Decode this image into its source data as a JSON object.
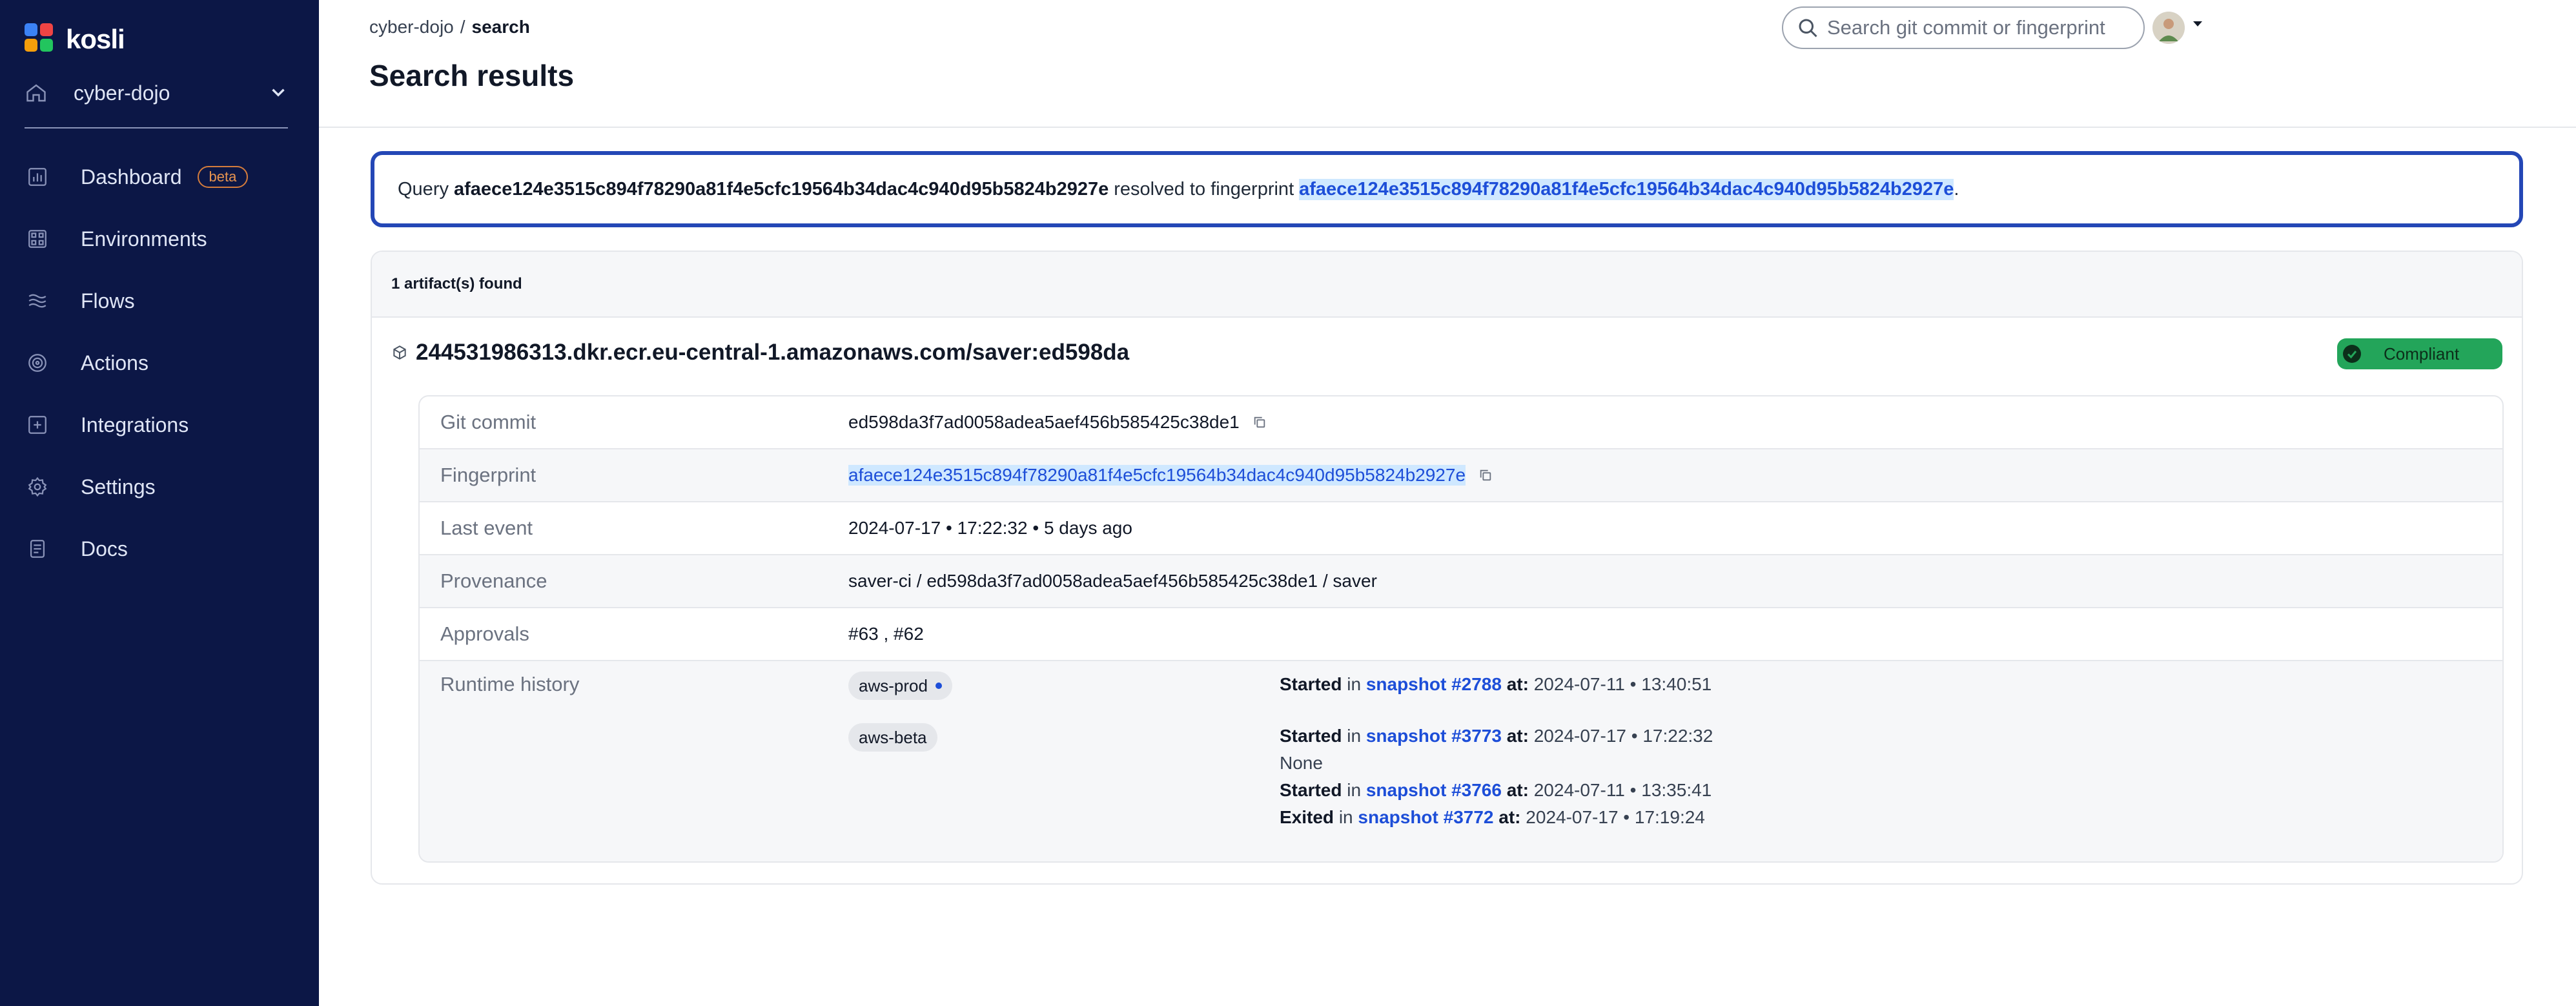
{
  "app": {
    "name": "kosli"
  },
  "sidebar": {
    "org": "cyber-dojo",
    "items": [
      {
        "label": "Dashboard",
        "badge": "beta"
      },
      {
        "label": "Environments"
      },
      {
        "label": "Flows"
      },
      {
        "label": "Actions"
      },
      {
        "label": "Integrations"
      },
      {
        "label": "Settings"
      },
      {
        "label": "Docs"
      }
    ]
  },
  "header": {
    "breadcrumb": {
      "org": "cyber-dojo",
      "separator": "/",
      "current": "search"
    },
    "title": "Search results",
    "search_placeholder": "Search git commit or fingerprint"
  },
  "query": {
    "prefix": "Query",
    "value": "afaece124e3515c894f78290a81f4e5cfc19564b34dac4c940d95b5824b2927e",
    "middle": "resolved to fingerprint",
    "fingerprint": "afaece124e3515c894f78290a81f4e5cfc19564b34dac4c940d95b5824b2927e",
    "suffix": "."
  },
  "results": {
    "count_text": "1 artifact(s) found",
    "artifact": {
      "name": "244531986313.dkr.ecr.eu-central-1.amazonaws.com/saver:ed598da",
      "status": "Compliant",
      "status_color": "#23a55a",
      "details": {
        "git_commit": {
          "label": "Git commit",
          "value": "ed598da3f7ad0058adea5aef456b585425c38de1"
        },
        "fingerprint": {
          "label": "Fingerprint",
          "value": "afaece124e3515c894f78290a81f4e5cfc19564b34dac4c940d95b5824b2927e"
        },
        "last_event": {
          "label": "Last event",
          "value": "2024-07-17 • 17:22:32 • 5 days ago"
        },
        "provenance": {
          "label": "Provenance",
          "value": "saver-ci / ed598da3f7ad0058adea5aef456b585425c38de1 / saver"
        },
        "approvals": {
          "label": "Approvals",
          "value": "#63 , #62"
        }
      },
      "runtime_history": {
        "label": "Runtime history",
        "environments": [
          {
            "name": "aws-prod",
            "events": [
              {
                "action": "Started",
                "in": "in",
                "snapshot": "snapshot #2788",
                "at": "at:",
                "time": "2024-07-11 • 13:40:51"
              }
            ]
          },
          {
            "name": "aws-beta",
            "events": [
              {
                "action": "Started",
                "in": "in",
                "snapshot": "snapshot #3773",
                "at": "at:",
                "time": "2024-07-17 • 17:22:32"
              }
            ],
            "note": "None",
            "extra_events": [
              {
                "action": "Started",
                "in": "in",
                "snapshot": "snapshot #3766",
                "at": "at:",
                "time": "2024-07-11 • 13:35:41"
              },
              {
                "action": "Exited",
                "in": "in",
                "snapshot": "snapshot #3772",
                "at": "at:",
                "time": "2024-07-17 • 17:19:24"
              }
            ]
          }
        ]
      }
    }
  },
  "colors": {
    "sidebar_bg": "#0c1746",
    "link": "#1d4ed8",
    "highlight": "#cfe8ff",
    "query_border": "#2447b6"
  }
}
